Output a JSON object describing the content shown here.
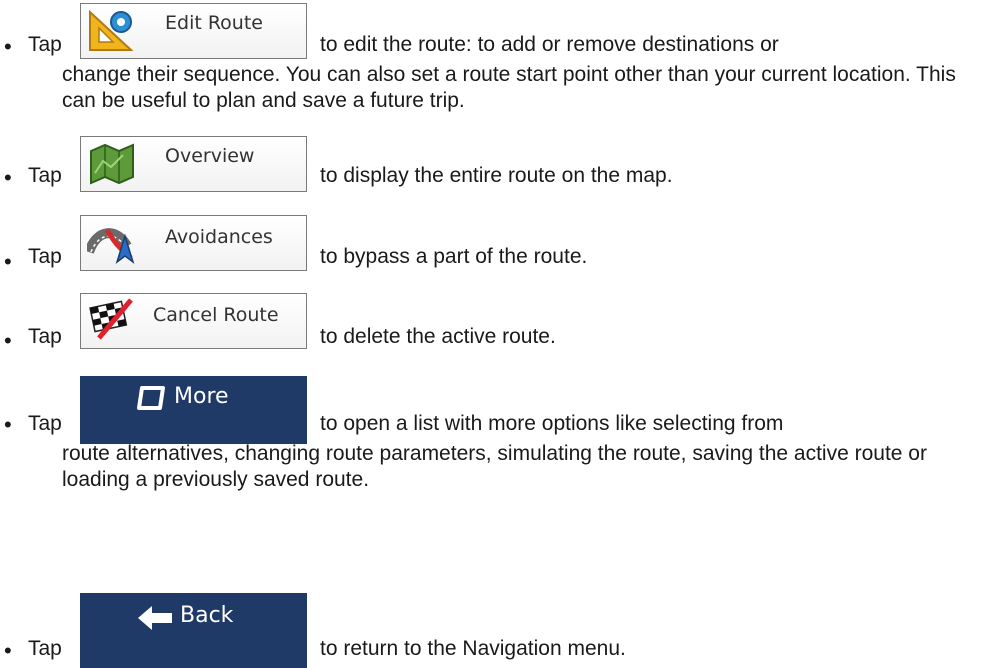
{
  "items": [
    {
      "tap": "Tap",
      "button_label": "Edit Route",
      "icon": "ruler-triangle-icon",
      "desc": "to edit the route: to add or remove destinations or",
      "cont": "change their sequence. You can also set a route start point other than your current location. This can be useful to plan and save a future trip."
    },
    {
      "tap": "Tap",
      "button_label": "Overview",
      "icon": "map-icon",
      "desc": "to display the entire route on the map."
    },
    {
      "tap": "Tap",
      "button_label": "Avoidances",
      "icon": "road-avoid-icon",
      "desc": "to bypass a part of the route."
    },
    {
      "tap": "Tap",
      "button_label": "Cancel Route",
      "icon": "checkered-flag-cancel-icon",
      "desc": "to delete the active route."
    },
    {
      "tap": "Tap",
      "button_label": "More",
      "icon": "more-square-icon",
      "desc": "to open a list with more options like selecting from",
      "cont": "route alternatives, changing route parameters, simulating the route, saving the active route or loading a previously saved route."
    },
    {
      "tap": "Tap",
      "button_label": "Back",
      "icon": "arrow-left-icon",
      "desc": "to return to the Navigation menu."
    }
  ],
  "colors": {
    "dark_button": "#1f3a66",
    "text": "#1a1a1a"
  }
}
